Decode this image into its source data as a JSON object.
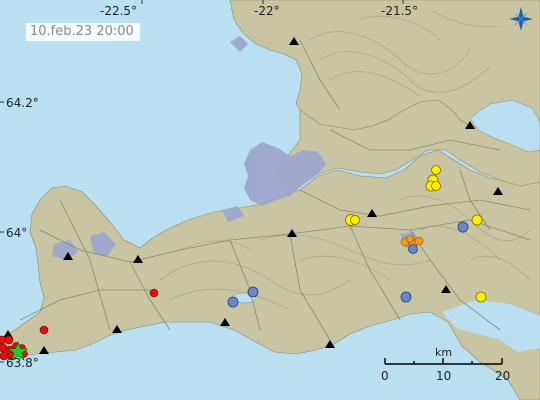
{
  "timestamp": "10.feb.23 20:00",
  "graticule": {
    "lon_top": [
      "-22.5°",
      "-22°",
      "-21.5°"
    ],
    "lat_left": [
      "64.2°",
      "64°",
      "63.8°"
    ]
  },
  "scale_bar": {
    "unit_label": "km",
    "ticks": [
      "0",
      "10",
      "20"
    ]
  },
  "colors": {
    "sea": "#b9dff0",
    "land": "#c9c4a1",
    "contour": "#a89478",
    "lava": "#9ea7cf",
    "roads": "#7a8a72",
    "quake_red": "#e01010",
    "quake_orange": "#f39a1c",
    "quake_yellow": "#ffee00",
    "quake_blue": "#6a86c8",
    "largest_star": "#22cc22"
  },
  "icons": {
    "compass": "compass-rose-icon",
    "station": "seismic-station-triangle",
    "large_quake": "green-star-icon"
  },
  "earthquakes": {
    "red": 12,
    "orange": 4,
    "yellow": 8,
    "blue": 5,
    "large_star": 1
  },
  "stations": 15
}
